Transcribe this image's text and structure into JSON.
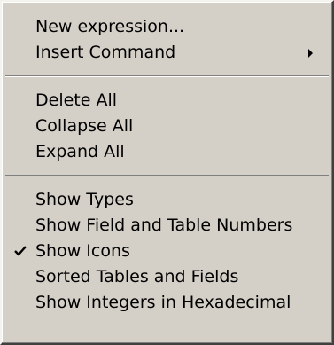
{
  "menu": {
    "group1": [
      {
        "label": "New expression..."
      },
      {
        "label": "Insert Command",
        "submenu_icon": "submenu-arrow-icon"
      }
    ],
    "group2": [
      {
        "label": "Delete All"
      },
      {
        "label": "Collapse All"
      },
      {
        "label": "Expand All"
      }
    ],
    "group3": [
      {
        "label": "Show Types"
      },
      {
        "label": "Show Field and Table Numbers"
      },
      {
        "label": "Show Icons",
        "checked": true,
        "check_icon": "checkmark-icon"
      },
      {
        "label": "Sorted Tables and Fields"
      },
      {
        "label": "Show Integers in Hexadecimal"
      }
    ]
  },
  "colors": {
    "menu_background": "#d4d0c8",
    "text": "#000000",
    "separator_dark": "#808080",
    "separator_light": "#ffffff"
  }
}
